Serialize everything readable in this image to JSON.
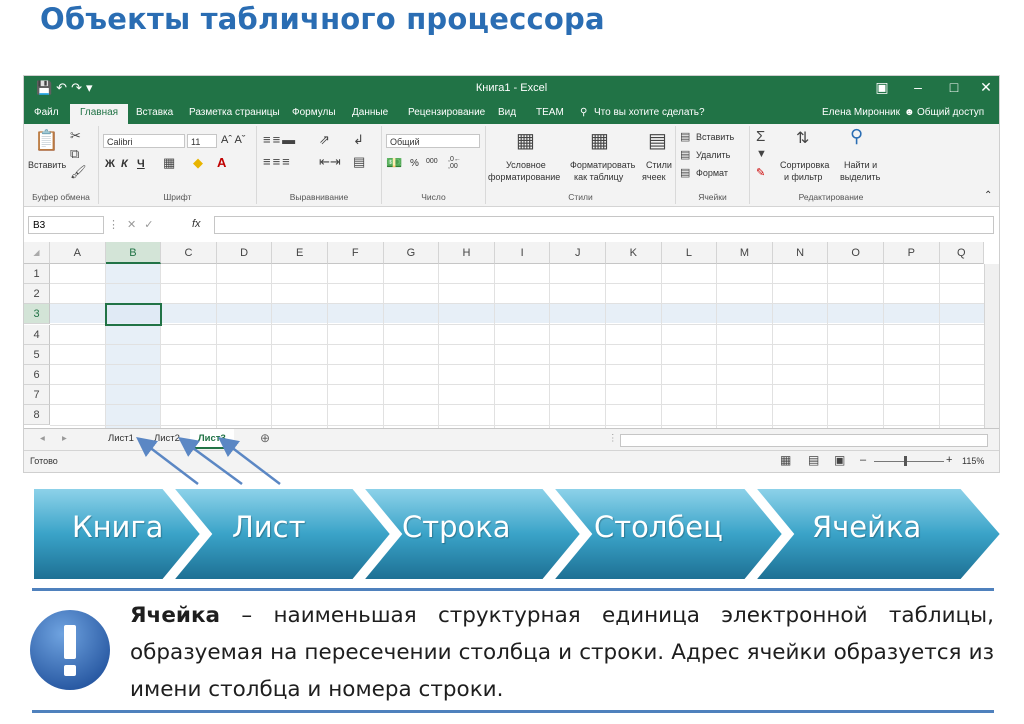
{
  "slide": {
    "title": "Объекты табличного процессора",
    "chevrons": [
      "Книга",
      "Лист",
      "Строка",
      "Столбец",
      "Ячейка"
    ],
    "note": {
      "term": "Ячейка",
      "definition": " – наименьшая структурная единица электронной таблицы, образуемая на пересечении столбца и строки. Адрес ячейки образуется из имени столбца и номера строки.",
      "icon": "exclamation-icon"
    }
  },
  "excel": {
    "window_title": "Книга1 - Excel",
    "tabs": [
      "Файл",
      "Главная",
      "Вставка",
      "Разметка страницы",
      "Формулы",
      "Данные",
      "Рецензирование",
      "Вид",
      "TEAM"
    ],
    "active_tab": "Главная",
    "tell_me": "Что вы хотите сделать?",
    "user": "Елена Миронник",
    "share": "Общий доступ",
    "ribbon": {
      "clipboard": {
        "label": "Буфер обмена",
        "paste": "Вставить"
      },
      "font": {
        "label": "Шрифт",
        "name": "Calibri",
        "size": "11",
        "bold": "Ж",
        "italic": "К",
        "underline": "Ч"
      },
      "alignment": {
        "label": "Выравнивание"
      },
      "number": {
        "label": "Число",
        "format": "Общий"
      },
      "styles": {
        "label": "Стили",
        "conditional": [
          "Условное",
          "форматирование"
        ],
        "as_table": [
          "Форматировать",
          "как таблицу"
        ],
        "cell_styles": [
          "Стили",
          "ячеек"
        ]
      },
      "cells": {
        "label": "Ячейки",
        "insert": "Вставить",
        "delete": "Удалить",
        "format": "Формат"
      },
      "editing": {
        "label": "Редактирование",
        "sort": [
          "Сортировка",
          "и фильтр"
        ],
        "find": [
          "Найти и",
          "выделить"
        ]
      }
    },
    "name_box": "B3",
    "fx": "fx",
    "columns": [
      "A",
      "B",
      "C",
      "D",
      "E",
      "F",
      "G",
      "H",
      "I",
      "J",
      "K",
      "L",
      "M",
      "N",
      "O",
      "P",
      "Q"
    ],
    "rows": [
      "1",
      "2",
      "3",
      "4",
      "5",
      "6",
      "7",
      "8"
    ],
    "selected_column": "B",
    "selected_row": "3",
    "sheets": [
      "Лист1",
      "Лист2",
      "Лист3"
    ],
    "active_sheet": "Лист3",
    "status": "Готово",
    "zoom": "115%",
    "colors": {
      "excel_green": "#217346",
      "accent_blue": "#2a6db3",
      "chevron_teal": "#2f8db3"
    }
  }
}
